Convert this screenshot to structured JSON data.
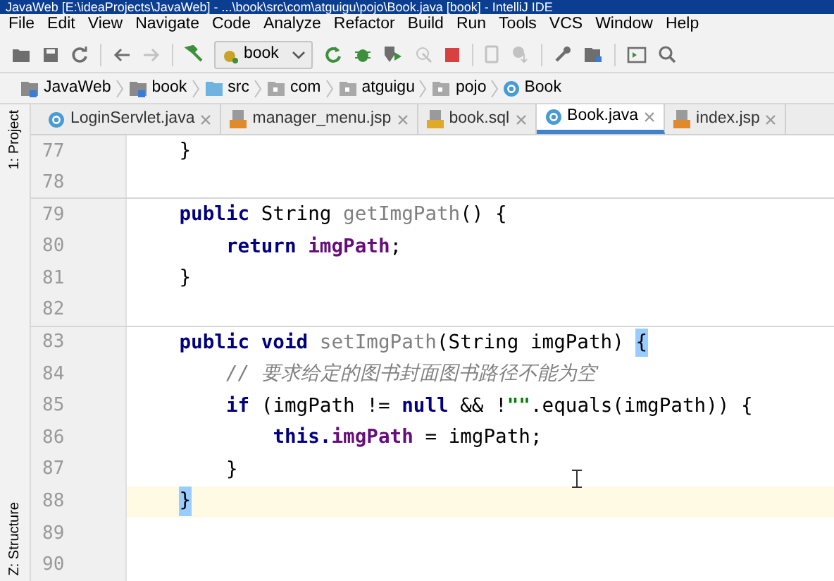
{
  "window": {
    "title": "JavaWeb [E:\\ideaProjects\\JavaWeb] - ...\\book\\src\\com\\atguigu\\pojo\\Book.java [book] - IntelliJ IDE"
  },
  "menu": [
    "File",
    "Edit",
    "View",
    "Navigate",
    "Code",
    "Analyze",
    "Refactor",
    "Build",
    "Run",
    "Tools",
    "VCS",
    "Window",
    "Help"
  ],
  "run_config": "book",
  "breadcrumbs": [
    {
      "label": "JavaWeb",
      "kind": "module"
    },
    {
      "label": "book",
      "kind": "module"
    },
    {
      "label": "src",
      "kind": "source"
    },
    {
      "label": "com",
      "kind": "package"
    },
    {
      "label": "atguigu",
      "kind": "package"
    },
    {
      "label": "pojo",
      "kind": "package"
    },
    {
      "label": "Book",
      "kind": "class"
    }
  ],
  "tabs": [
    {
      "label": "LoginServlet.java",
      "kind": "class",
      "selected": false
    },
    {
      "label": "manager_menu.jsp",
      "kind": "jsp",
      "selected": false
    },
    {
      "label": "book.sql",
      "kind": "sql",
      "selected": false
    },
    {
      "label": "Book.java",
      "kind": "class",
      "selected": true
    },
    {
      "label": "index.jsp",
      "kind": "jsp",
      "selected": false
    }
  ],
  "side_tools": [
    "1: Project",
    "Z: Structure"
  ],
  "lines": [
    {
      "number": "77",
      "separator": false,
      "current": false,
      "tokens": [
        {
          "text": "    }",
          "kind": "plain"
        }
      ]
    },
    {
      "number": "78",
      "separator": true,
      "current": false
    },
    {
      "number": "79",
      "separator": false,
      "current": false,
      "tokens": [
        {
          "text": "    public",
          "kind": "keyword"
        },
        {
          "text": " String ",
          "kind": "plain"
        },
        {
          "text": "getImgPath",
          "kind": "unused"
        },
        {
          "text": "() {",
          "kind": "plain"
        }
      ]
    },
    {
      "number": "80",
      "separator": false,
      "current": false,
      "tokens": [
        {
          "text": "        return ",
          "kind": "keyword"
        },
        {
          "text": "imgPath",
          "kind": "field"
        },
        {
          "text": ";",
          "kind": "plain"
        }
      ]
    },
    {
      "number": "81",
      "separator": false,
      "current": false,
      "tokens": [
        {
          "text": "    }",
          "kind": "plain"
        }
      ]
    },
    {
      "number": "82",
      "separator": true,
      "current": false
    },
    {
      "number": "83",
      "separator": false,
      "current": false,
      "tokens": [
        {
          "text": "    public void ",
          "kind": "keyword"
        },
        {
          "text": "setImgPath",
          "kind": "unused"
        },
        {
          "text": "(String imgPath) ",
          "kind": "plain"
        },
        {
          "text": "{",
          "kind": "brace_match"
        }
      ]
    },
    {
      "number": "84",
      "separator": false,
      "current": false,
      "tokens": [
        {
          "text": "        // 要求给定的图书封面图书路径不能为空",
          "kind": "comment"
        }
      ]
    },
    {
      "number": "85",
      "separator": false,
      "current": false,
      "tokens": [
        {
          "text": "        if",
          "kind": "keyword"
        },
        {
          "text": " (imgPath != ",
          "kind": "plain"
        },
        {
          "text": "null",
          "kind": "keyword"
        },
        {
          "text": " && !",
          "kind": "plain"
        },
        {
          "text": "\"\"",
          "kind": "string"
        },
        {
          "text": ".equals(imgPath)) {",
          "kind": "plain"
        }
      ]
    },
    {
      "number": "86",
      "separator": false,
      "current": false,
      "tokens": [
        {
          "text": "            this.",
          "kind": "keyword"
        },
        {
          "text": "imgPath",
          "kind": "field"
        },
        {
          "text": " = imgPath;",
          "kind": "plain"
        }
      ]
    },
    {
      "number": "87",
      "separator": false,
      "current": false,
      "tokens": [
        {
          "text": "        }",
          "kind": "plain"
        }
      ]
    },
    {
      "number": "88",
      "separator": false,
      "current": true,
      "tokens": [
        {
          "text": "    }",
          "kind": "brace_match"
        }
      ]
    },
    {
      "number": "89",
      "separator": false,
      "current": false
    },
    {
      "number": "90",
      "separator": false,
      "current": false
    }
  ]
}
